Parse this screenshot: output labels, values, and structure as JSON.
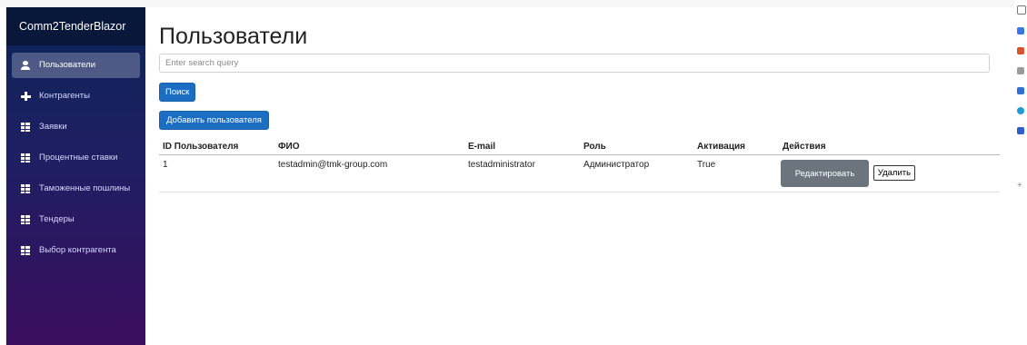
{
  "app": {
    "title": "Comm2TenderBlazor"
  },
  "sidebar": {
    "items": [
      {
        "label": "Пользователи",
        "icon": "user-icon",
        "active": true
      },
      {
        "label": "Контрагенты",
        "icon": "plus-icon",
        "active": false
      },
      {
        "label": "Заявки",
        "icon": "list-icon",
        "active": false
      },
      {
        "label": "Процентные ставки",
        "icon": "list-icon",
        "active": false
      },
      {
        "label": "Таможенные пошлины",
        "icon": "list-icon",
        "active": false
      },
      {
        "label": "Тендеры",
        "icon": "list-icon",
        "active": false
      },
      {
        "label": "Выбор контрагента",
        "icon": "list-icon",
        "active": false
      }
    ]
  },
  "page": {
    "title": "Пользователи",
    "search": {
      "placeholder": "Enter search query",
      "value": ""
    },
    "search_button": "Поиск",
    "add_button": "Добавить пользователя"
  },
  "table": {
    "columns": [
      "ID Пользователя",
      "ФИО",
      "E-mail",
      "Роль",
      "Активация",
      "Действия"
    ],
    "rows": [
      {
        "id": "1",
        "fio": "testadmin@tmk-group.com",
        "email": "testadministrator",
        "role": "Администратор",
        "activation": "True",
        "edit_label": "Редактировать",
        "delete_label": "Удалить"
      }
    ]
  },
  "colors": {
    "accent": "#1b6ec2",
    "sidebar_top": "#0b2558",
    "sidebar_bottom": "#3a0d5e",
    "edit_button": "#6c757d"
  }
}
